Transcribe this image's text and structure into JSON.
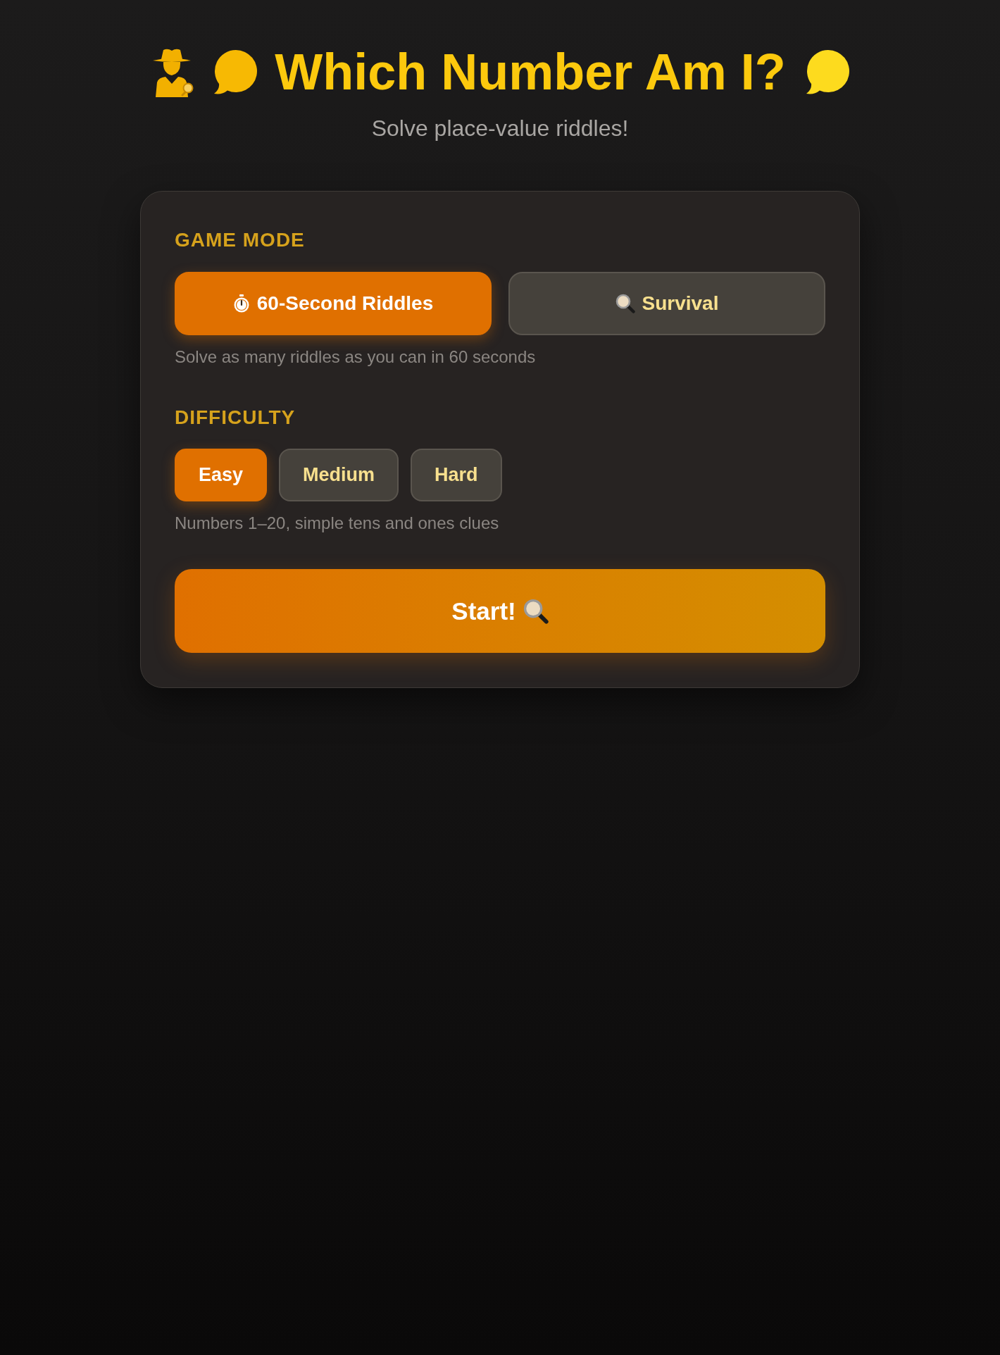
{
  "header": {
    "title": "Which Number Am I?",
    "subtitle": "Solve place-value riddles!"
  },
  "game_mode": {
    "label": "GAME MODE",
    "options": [
      {
        "label": "60-Second Riddles",
        "kind": "timed",
        "selected": true
      },
      {
        "label": "Survival",
        "kind": "survival",
        "selected": false
      }
    ],
    "description": "Solve as many riddles as you can in 60 seconds"
  },
  "difficulty": {
    "label": "DIFFICULTY",
    "options": [
      {
        "label": "Easy",
        "selected": true
      },
      {
        "label": "Medium",
        "selected": false
      },
      {
        "label": "Hard",
        "selected": false
      }
    ],
    "description": "Numbers 1–20, simple tens and ones clues"
  },
  "start_button": {
    "label": "Start!"
  }
}
